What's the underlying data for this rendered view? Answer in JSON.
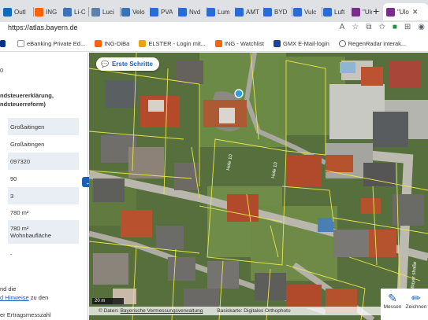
{
  "browser": {
    "tabs": [
      {
        "label": "Outl",
        "color": "#0f6cbd"
      },
      {
        "label": "ING",
        "color": "#ff6200"
      },
      {
        "label": "Li-C",
        "color": "#3b73b9"
      },
      {
        "label": "Luci",
        "color": "#5e81ac"
      },
      {
        "label": "Velo",
        "color": "#3b73b9"
      },
      {
        "label": "PVA",
        "color": "#2a6cd6"
      },
      {
        "label": "Nvd",
        "color": "#2a6cd6"
      },
      {
        "label": "Lum",
        "color": "#2a6cd6"
      },
      {
        "label": "AMT",
        "color": "#2a6cd6"
      },
      {
        "label": "BYD",
        "color": "#2a6cd6"
      },
      {
        "label": "Vulc",
        "color": "#2a6cd6"
      },
      {
        "label": "Luft",
        "color": "#2a6cd6"
      },
      {
        "label": "\"Ulo",
        "color": "#7b2d8b"
      },
      {
        "label": "\"Ulo",
        "color": "#7b2d8b"
      }
    ],
    "active_tab_label": "\"Ulo",
    "new_tab_glyph": "+",
    "url": "https://atlas.bayern.de",
    "bookmarks": [
      {
        "label": "",
        "icon": "paypal-icon",
        "color": "#003087"
      },
      {
        "label": "eBanking Private Ed...",
        "icon": "bank-icon",
        "color": "#f0f0f0"
      },
      {
        "label": "ING-DiBa",
        "icon": "ing-icon",
        "color": "#ff6200"
      },
      {
        "label": "ELSTER - Login mit...",
        "icon": "elster-icon",
        "color": "#e8a400"
      },
      {
        "label": "ING - Watchlist",
        "icon": "ing-icon",
        "color": "#ff6200"
      },
      {
        "label": "GMX E-Mail-login",
        "icon": "gmx-icon",
        "color": "#1c449b"
      },
      {
        "label": "RegenRadar interak...",
        "icon": "globe-icon",
        "color": "#5f6368"
      }
    ]
  },
  "panel": {
    "header_fragment": "0",
    "header_line1": "ndsteuererklärung,",
    "header_line2": "ndsteuerreform)",
    "rows": [
      "Großaitingen",
      "Großaitingen",
      "097320",
      "90",
      "3",
      "780 m²",
      "780 m²",
      "Wohnbaufläche",
      "-"
    ],
    "footer_line1": "nd die",
    "footer_line2_link": "d Hinweise",
    "footer_line2_rest": "zu den",
    "footer_line3": "er Ertragsmesszahl"
  },
  "map": {
    "erste_schritte": "Erste Schritte",
    "scale_label": "20 m",
    "attribution_prefix": "© Daten:",
    "attribution_link": "Bayerische Vermessungsverwaltung",
    "attribution_base": "Basiskarte: Digitales Orthophoto",
    "road_label_1": "Hole 10",
    "road_label_2": "Hole 10",
    "road_label_3": "Bayer straße",
    "tools": [
      {
        "label": "Messen",
        "icon": "ruler-icon"
      },
      {
        "label": "Zeichnen",
        "icon": "pencil-icon"
      }
    ]
  }
}
